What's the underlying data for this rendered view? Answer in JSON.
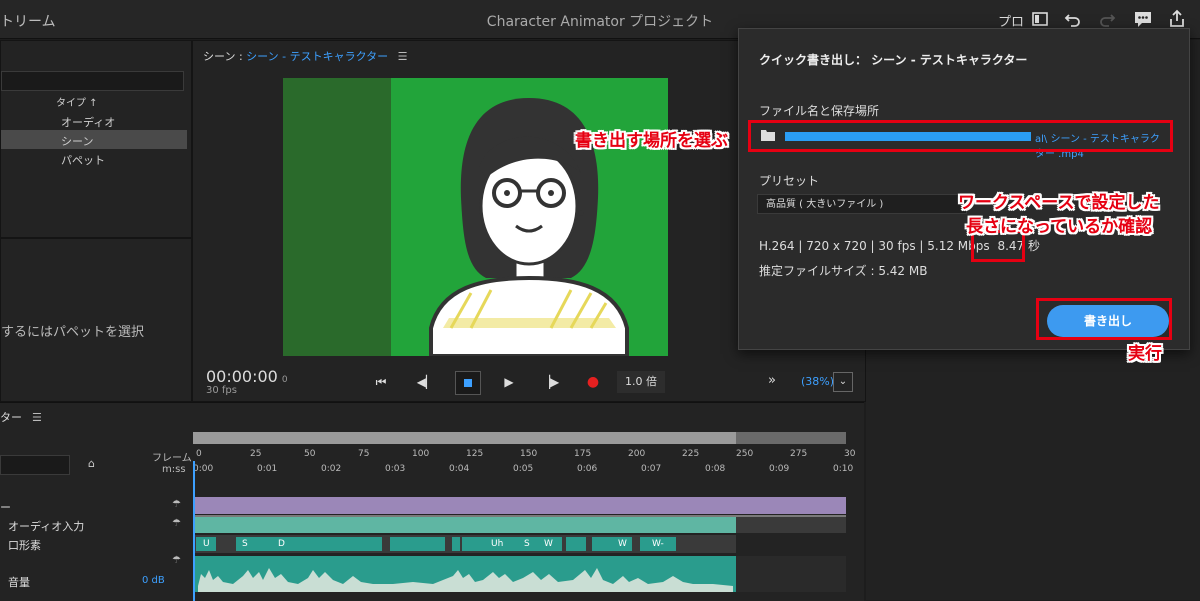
{
  "titlebar": {
    "app_fragment": "トリーム",
    "project_title": "Character Animator プロジェクト",
    "mode_label": "プロ"
  },
  "project_panel": {
    "column_header": "タイプ ↑",
    "rows": [
      "オーディオ",
      "シーン",
      "パペット"
    ],
    "selected_index": 1
  },
  "properties_panel": {
    "hint": "するにはパペットを選択"
  },
  "scene_panel": {
    "title_prefix": "シーン :",
    "title_name": "シーン - テストキャラクター",
    "timecode": "00:00:00",
    "timecode_frame": "0",
    "fps": "30 fps",
    "speed": "1.0 倍",
    "zoom": "(38%)",
    "stage_color": "#22a43a"
  },
  "timeline": {
    "title_fragment": "ター",
    "frame_label": "フレーム",
    "mss_label": "m:ss",
    "frame_ticks": [
      "0",
      "25",
      "50",
      "75",
      "100",
      "125",
      "150",
      "175",
      "200",
      "225",
      "250",
      "275",
      "30"
    ],
    "time_ticks": [
      "0:00",
      "0:01",
      "0:02",
      "0:03",
      "0:04",
      "0:05",
      "0:06",
      "0:07",
      "0:08",
      "0:09",
      "0:10"
    ],
    "tracks": [
      {
        "label": "ー",
        "color": "#9b87b8"
      },
      {
        "label": "オーディオ入力",
        "color": "#5fb6a3"
      },
      {
        "label": "口形素",
        "color": "#2a9c8d"
      },
      {
        "label": "音量",
        "color": "#2a9c8d",
        "value": "0 dB"
      }
    ],
    "viseme_labels": [
      "U",
      "S",
      "D",
      "Uh",
      "S",
      "W",
      "W",
      "W-"
    ]
  },
  "quick_export": {
    "title": "クイック書き出し：  シーン - テストキャラクター",
    "file_label": "ファイル名と保存場所",
    "path_suffix": "al\\ シーン - テストキャラクター .mp4",
    "preset_label": "プリセット",
    "preset_value": "高品質 ( 大きいファイル )",
    "specs": "H.264 | 720 x 720 | 30 fps | 5.12 Mbps",
    "duration": "8.47 秒",
    "size": "推定ファイルサイズ : 5.42 MB",
    "export_button": "書き出し"
  },
  "annotations": {
    "choose_location": "書き出す場所を選ぶ",
    "check_length_line1": "ワークスペースで設定した",
    "check_length_line2": "長さになっているか確認",
    "execute": "実行"
  },
  "colors": {
    "accent_blue": "#3da0ff",
    "annotation_red": "#e60012",
    "export_button": "#3d9af0"
  }
}
